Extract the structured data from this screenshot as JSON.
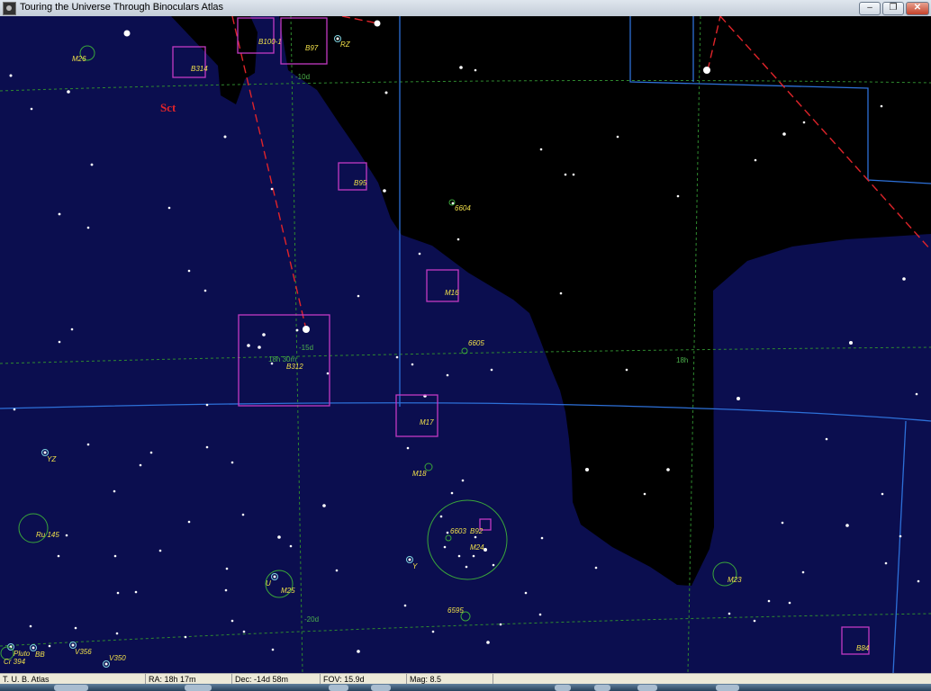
{
  "window": {
    "title": "Touring the Universe Through Binoculars Atlas"
  },
  "window_buttons": [
    {
      "name": "minimize-button",
      "icon": "minimize-icon",
      "glyph": "–"
    },
    {
      "name": "restore-button",
      "icon": "restore-icon",
      "glyph": "❐"
    },
    {
      "name": "close-button",
      "icon": "close-icon",
      "glyph": "✕"
    }
  ],
  "map": {
    "constellation_labels": [
      "Sct"
    ],
    "grid_labels": [
      "-10d",
      "-15d",
      "-20d",
      "18h 30m",
      "18h"
    ],
    "objects": [
      {
        "id": "m26",
        "label": "M26",
        "kind": "cluster"
      },
      {
        "id": "b314",
        "label": "B314",
        "kind": "dark-nebula"
      },
      {
        "id": "b100-1",
        "label": "B100-1",
        "kind": "dark-nebula"
      },
      {
        "id": "b97",
        "label": "B97",
        "kind": "dark-nebula"
      },
      {
        "id": "rz",
        "label": "RZ",
        "kind": "variable-star"
      },
      {
        "id": "b95",
        "label": "B95",
        "kind": "dark-nebula"
      },
      {
        "id": "ngc6604",
        "label": "6604",
        "kind": "cluster"
      },
      {
        "id": "m16",
        "label": "M16",
        "kind": "dark-nebula"
      },
      {
        "id": "ngc6605",
        "label": "6605",
        "kind": "cluster"
      },
      {
        "id": "b312",
        "label": "B312",
        "kind": "dark-nebula"
      },
      {
        "id": "m17",
        "label": "M17",
        "kind": "dark-nebula"
      },
      {
        "id": "yz",
        "label": "YZ",
        "kind": "variable-star"
      },
      {
        "id": "m18",
        "label": "M18",
        "kind": "cluster"
      },
      {
        "id": "ru145",
        "label": "Ru 145",
        "kind": "cluster"
      },
      {
        "id": "ngc6603",
        "label": "6603",
        "kind": "cluster"
      },
      {
        "id": "b92",
        "label": "B92",
        "kind": "dark-nebula"
      },
      {
        "id": "m24",
        "label": "M24",
        "kind": "cluster"
      },
      {
        "id": "y",
        "label": "Y",
        "kind": "variable-star"
      },
      {
        "id": "u",
        "label": "U",
        "kind": "variable-star"
      },
      {
        "id": "m25",
        "label": "M25",
        "kind": "cluster"
      },
      {
        "id": "m23",
        "label": "M23",
        "kind": "cluster"
      },
      {
        "id": "ngc6595",
        "label": "6595",
        "kind": "cluster"
      },
      {
        "id": "pluto",
        "label": "Pluto",
        "kind": "planet"
      },
      {
        "id": "bb",
        "label": "BB",
        "kind": "variable-star"
      },
      {
        "id": "v356",
        "label": "V356",
        "kind": "variable-star"
      },
      {
        "id": "v350",
        "label": "V350",
        "kind": "variable-star"
      },
      {
        "id": "cr394",
        "label": "Cr 394",
        "kind": "cluster"
      },
      {
        "id": "b84",
        "label": "B84",
        "kind": "dark-nebula"
      }
    ]
  },
  "status": {
    "app": "T. U. B. Atlas",
    "ra": "RA: 18h 17m",
    "dec": "Dec: -14d 58m",
    "fov": "FOV: 15.9d",
    "mag": "Mag: 8.5"
  },
  "colors": {
    "milky_way": "#0b0e4f",
    "sky": "#000000",
    "boundary": "#2d70d8",
    "grid": "#2f8a2f",
    "figure": "#e0242a",
    "dark_nebula": "#c239c2",
    "cluster": "#3aa63a",
    "labels": "#f1e04a",
    "stars": "#ffffff"
  }
}
